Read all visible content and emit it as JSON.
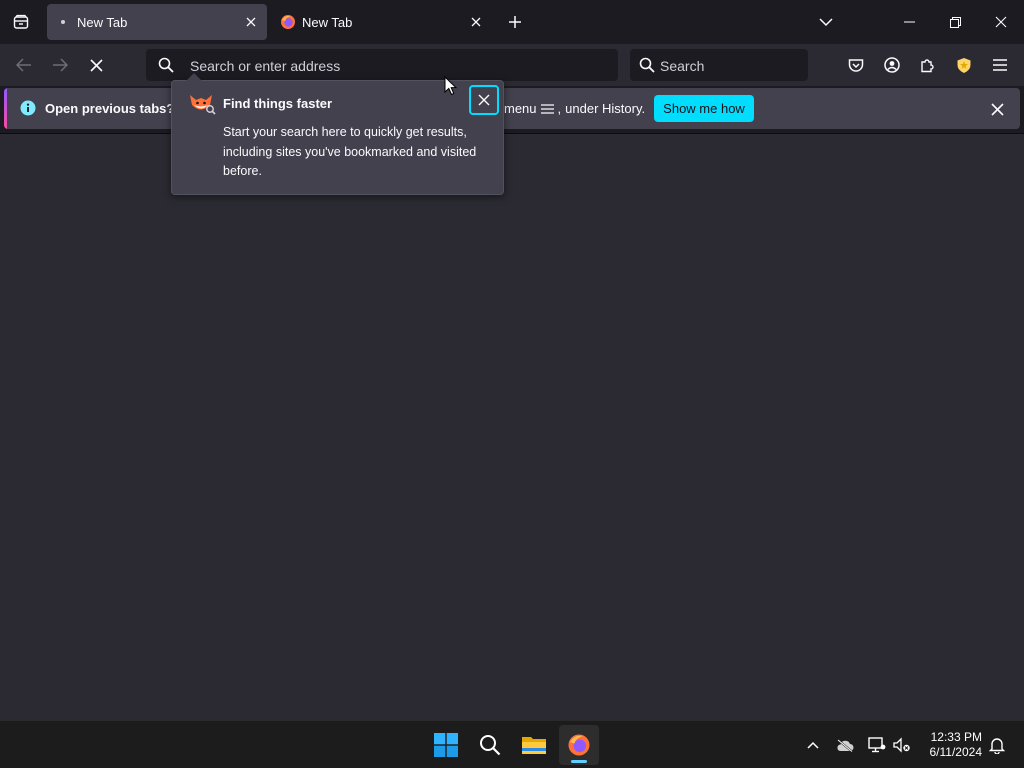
{
  "tabs": [
    {
      "label": "New Tab",
      "active": true
    },
    {
      "label": "New Tab",
      "active": false
    }
  ],
  "urlbar": {
    "placeholder": "Search or enter address"
  },
  "searchbar": {
    "placeholder": "Search"
  },
  "notification": {
    "text_start": "Open previous tabs? You",
    "text_end": "menu",
    "text_tail": "under History.",
    "button_label": "Show me how"
  },
  "popup": {
    "title": "Find things faster",
    "body": "Start your search here to quickly get results, including sites you've bookmarked and visited before."
  },
  "clock": {
    "time": "12:33 PM",
    "date": "6/11/2024"
  },
  "colors": {
    "accent": "#00ddff",
    "toolbar": "#2b2a33",
    "tabstrip": "#1c1b22",
    "panel": "#42414d"
  }
}
